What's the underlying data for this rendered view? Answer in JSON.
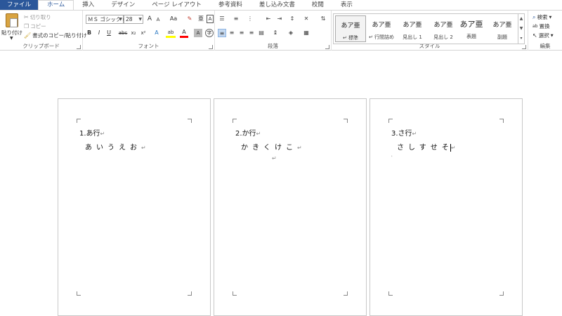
{
  "tabs": [
    "ファイル",
    "ホーム",
    "挿入",
    "デザイン",
    "ページ レイアウト",
    "参考資料",
    "差し込み文書",
    "校閲",
    "表示"
  ],
  "clipboard": {
    "paste": "貼り付け",
    "cut": "切り取り",
    "copy": "コピー",
    "format_painter": "書式のコピー/貼り付け",
    "label": "クリップボード"
  },
  "font": {
    "name": "ＭＳ ゴシック (",
    "size": "28",
    "grow": "A",
    "shrink": "A",
    "case": "Aa",
    "bold": "B",
    "italic": "I",
    "underline": "U",
    "strike": "abc",
    "subscript": "x₂",
    "superscript": "x²",
    "text_color": "A",
    "label": "フォント"
  },
  "paragraph": {
    "label": "段落"
  },
  "styles": {
    "items": [
      {
        "sample": "あア亜",
        "name": "↵ 標準"
      },
      {
        "sample": "あア亜",
        "name": "↵ 行間詰め"
      },
      {
        "sample": "あア亜",
        "name": "見出し 1"
      },
      {
        "sample": "あア亜",
        "name": "見出し 2"
      },
      {
        "sample": "あア亜",
        "name": "表題"
      },
      {
        "sample": "あア亜",
        "name": "副題"
      }
    ],
    "label": "スタイル"
  },
  "editing": {
    "find": "検索",
    "replace": "置換",
    "select": "選択",
    "label": "編集"
  },
  "pages": [
    {
      "heading": "1.あ行",
      "body": "あいうえお"
    },
    {
      "heading": "2.か行",
      "body": "かきくけこ"
    },
    {
      "heading": "3.さ行",
      "body": "さしすせそ"
    }
  ],
  "colors": {
    "file_tab": "#2b579a",
    "highlight": "#ffff00",
    "font_color": "#ff0000"
  },
  "icons": [
    "paste-icon",
    "cut-icon",
    "copy-icon",
    "format-painter-icon",
    "find-icon",
    "replace-icon",
    "select-icon"
  ]
}
